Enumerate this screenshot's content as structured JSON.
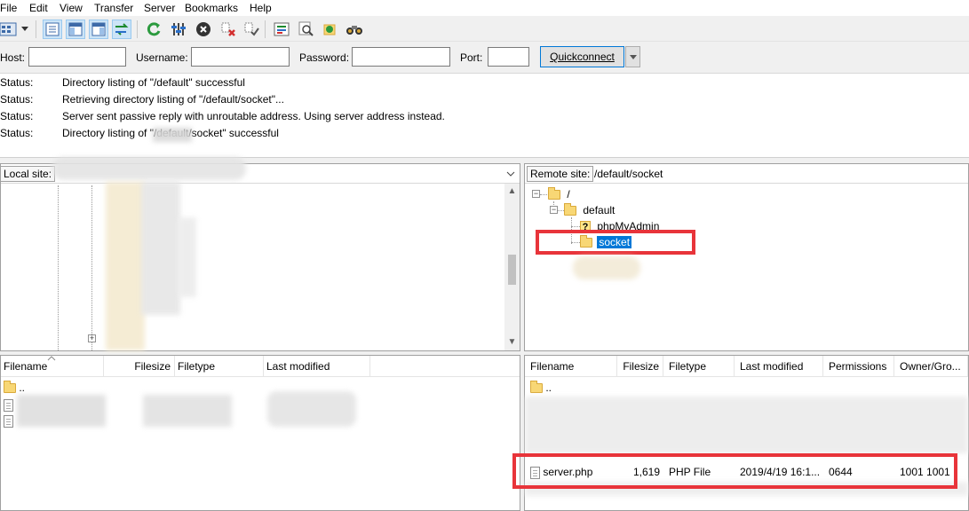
{
  "menubar": {
    "items": [
      "File",
      "Edit",
      "View",
      "Transfer",
      "Server",
      "Bookmarks",
      "Help"
    ]
  },
  "toolbar": {
    "icons": [
      "site-manager-icon",
      "dropdown-icon",
      "toggle-log-icon",
      "toggle-local-tree-icon",
      "toggle-remote-tree-icon",
      "transfer-queue-icon",
      "refresh-icon",
      "filter-process-icon",
      "cancel-icon",
      "disconnect-icon",
      "reconnect-icon",
      "dir-compare-icon",
      "search-icon",
      "sync-browse-icon",
      "find-files-icon"
    ]
  },
  "quickconnect": {
    "host_label": "Host:",
    "host_value": "",
    "username_label": "Username:",
    "username_value": "",
    "password_label": "Password:",
    "password_value": "",
    "port_label": "Port:",
    "port_value": "",
    "button_label": "Quickconnect"
  },
  "log": [
    {
      "label": "Status:",
      "message": "Directory listing of \"/default\" successful"
    },
    {
      "label": "Status:",
      "message": "Retrieving directory listing of \"/default/socket\"..."
    },
    {
      "label": "Status:",
      "message": "Server sent passive reply with unroutable address. Using server address instead."
    },
    {
      "label": "Status:",
      "message": "Directory listing of \"/default/socket\" successful"
    }
  ],
  "local": {
    "site_label": "Local site:",
    "site_value": "",
    "columns": [
      "Filename",
      "Filesize",
      "Filetype",
      "Last modified"
    ],
    "rows": [
      {
        "name": "..",
        "size": "",
        "type": "",
        "modified": ""
      },
      {
        "name": "",
        "size": "",
        "type": "",
        "modified": ""
      },
      {
        "name": "",
        "size": "",
        "type": "",
        "modified": ""
      }
    ]
  },
  "remote": {
    "site_label": "Remote site:",
    "site_value": "/default/socket",
    "tree": [
      {
        "label": "/",
        "level": 0,
        "icon": "folder-icon"
      },
      {
        "label": "default",
        "level": 1,
        "icon": "folder-icon"
      },
      {
        "label": "phpMyAdmin",
        "level": 2,
        "icon": "unknown-folder-icon"
      },
      {
        "label": "socket",
        "level": 2,
        "icon": "folder-icon",
        "selected": true
      }
    ],
    "columns": [
      "Filename",
      "Filesize",
      "Filetype",
      "Last modified",
      "Permissions",
      "Owner/Gro..."
    ],
    "rows": [
      {
        "name": "..",
        "size": "",
        "type": "",
        "modified": "",
        "perms": "",
        "owner": ""
      },
      {
        "name": "server.php",
        "size": "1,619",
        "type": "PHP File",
        "modified": "2019/4/19 16:1...",
        "perms": "0644",
        "owner": "1001 1001",
        "highlighted": true
      }
    ]
  },
  "colors": {
    "highlight_box": "#e8343a",
    "selection": "#0078d7"
  }
}
